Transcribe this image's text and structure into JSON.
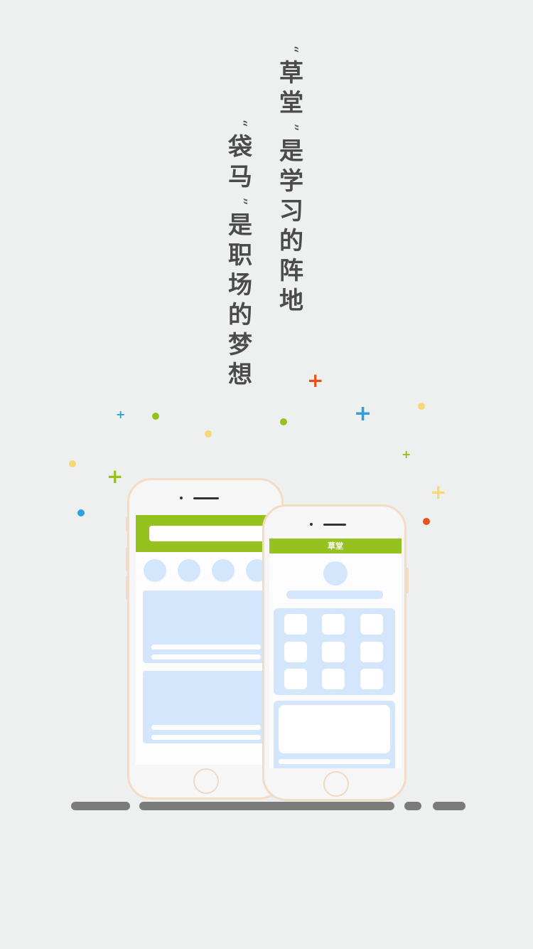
{
  "slogan": {
    "line1": {
      "open_quote": "“",
      "brand": [
        "草",
        "堂"
      ],
      "close_quote": "”",
      "rest": [
        "是",
        "学",
        "习",
        "的",
        "阵",
        "地"
      ]
    },
    "line2": {
      "open_quote": "“",
      "brand": [
        "袋",
        "马"
      ],
      "close_quote": "”",
      "rest": [
        "是",
        "职",
        "场",
        "的",
        "梦",
        "想"
      ]
    }
  },
  "front_phone": {
    "header_title": "草堂"
  },
  "colors": {
    "green": "#95c21e",
    "blue": "#2f9fe0",
    "orange": "#e8531c",
    "yellow": "#f6d77a",
    "light_blue": "#d3e6fb",
    "phone_border": "#f3dcc6",
    "bar": "#7b7b7b"
  }
}
